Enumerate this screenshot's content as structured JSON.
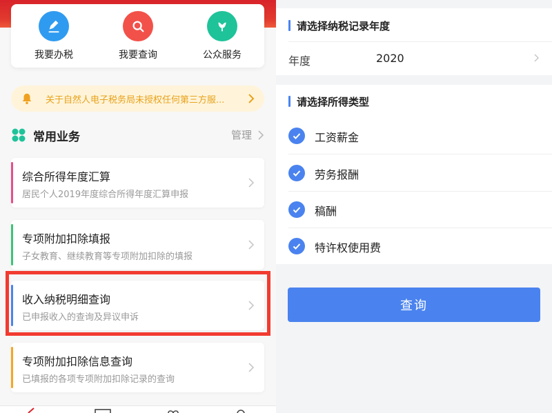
{
  "left": {
    "quick_actions": [
      {
        "label": "我要办税",
        "icon": "pen-icon",
        "color": "#2f9bf0"
      },
      {
        "label": "我要查询",
        "icon": "search-icon",
        "color": "#f2514a"
      },
      {
        "label": "公众服务",
        "icon": "tulip-icon",
        "color": "#1fc39a"
      }
    ],
    "notice": {
      "text": "关于自然人电子税务局未授权任何第三方服..."
    },
    "section": {
      "title": "常用业务",
      "manage_label": "管理"
    },
    "business_items": [
      {
        "title": "综合所得年度汇算",
        "subtitle": "居民个人2019年度综合所得年度汇算申报",
        "accent": "#e64e8a"
      },
      {
        "title": "专项附加扣除填报",
        "subtitle": "子女教育、继续教育等专项附加扣除的填报",
        "accent": "#3cc27a"
      },
      {
        "title": "收入纳税明细查询",
        "subtitle": "已申报收入的查询及异议申诉",
        "accent": "#4a83ef"
      },
      {
        "title": "专项附加扣除信息查询",
        "subtitle": "已填报的各项专项附加扣除记录的查询",
        "accent": "#f5a623"
      }
    ]
  },
  "right": {
    "year_section": {
      "heading": "请选择纳税记录年度",
      "label": "年度",
      "value": "2020"
    },
    "type_section": {
      "heading": "请选择所得类型",
      "options": [
        {
          "label": "工资薪金",
          "checked": true
        },
        {
          "label": "劳务报酬",
          "checked": true
        },
        {
          "label": "稿酬",
          "checked": true
        },
        {
          "label": "特许权使用费",
          "checked": true
        }
      ]
    },
    "query_button": "查询"
  },
  "colors": {
    "brand_red": "#d8232a",
    "primary_blue": "#4a83ef",
    "highlight_red": "#f23b30"
  }
}
